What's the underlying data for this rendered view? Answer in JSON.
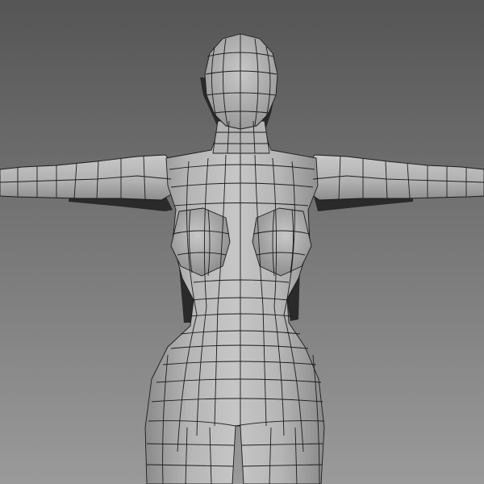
{
  "viewport": {
    "kind": "3d-viewport",
    "background": {
      "top": "#555555",
      "bottom": "#9a9a9a"
    }
  },
  "model": {
    "subject": "humanoid-base-mesh",
    "pose": "t-pose",
    "display_mode": "shaded-with-wireframe",
    "colors": {
      "surface_light": "#c4c4c4",
      "surface_mid": "#a9a9a9",
      "surface_dark": "#8a8a8a",
      "shadow": "#2a2a2a",
      "wire": "#1c1c1c"
    }
  }
}
